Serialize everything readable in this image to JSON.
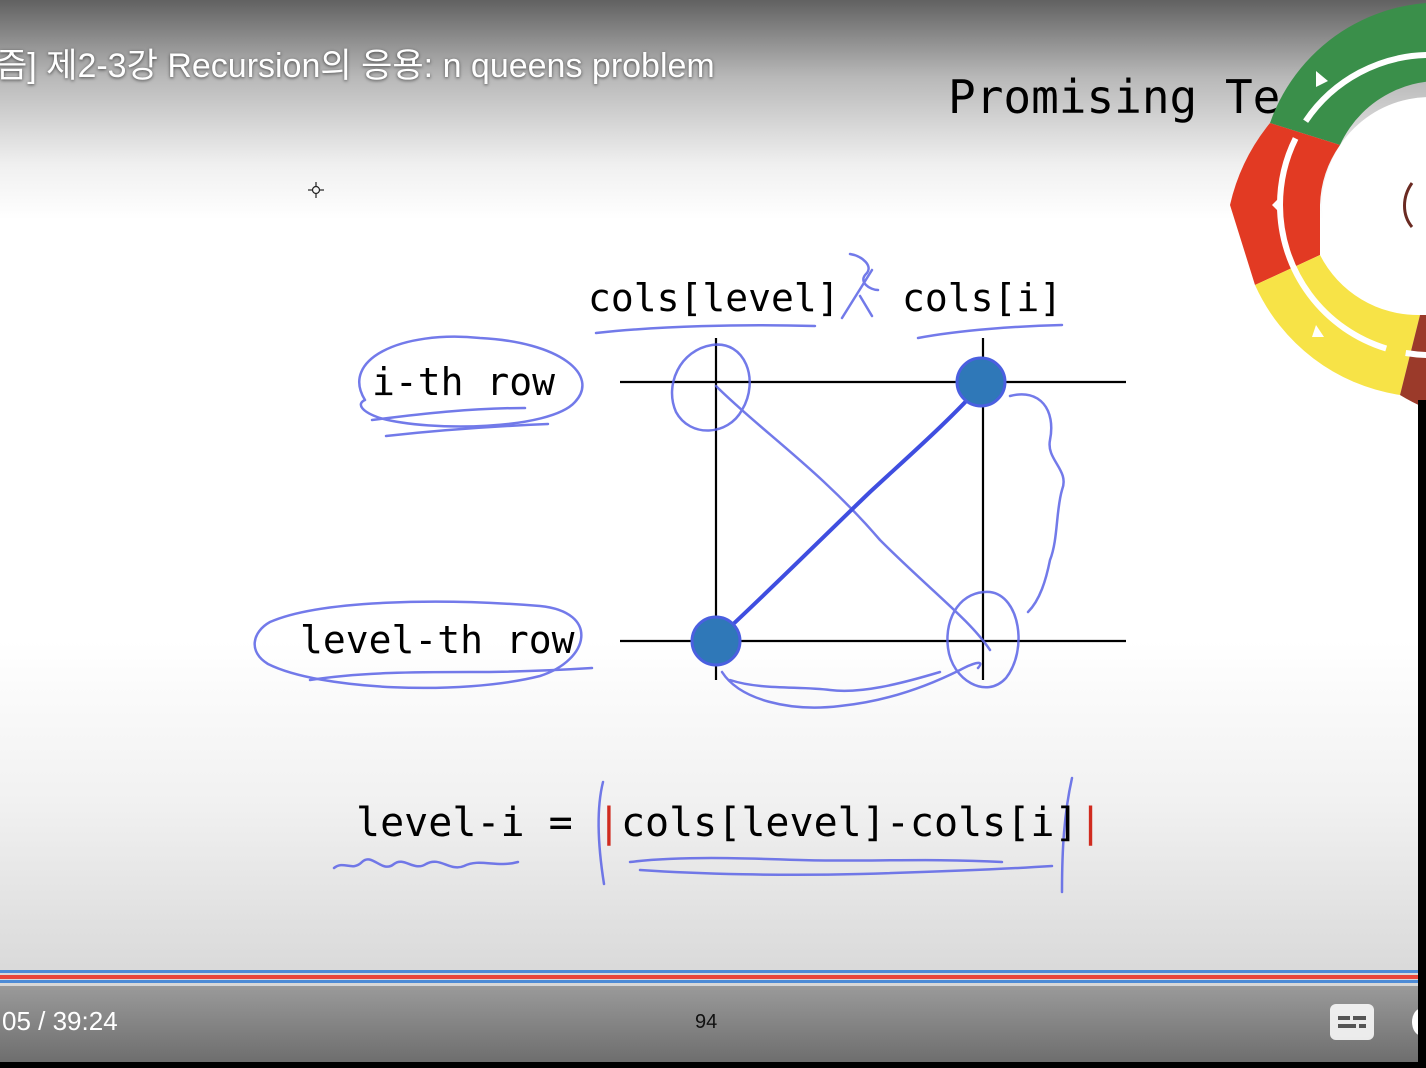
{
  "video": {
    "title": "즘] 제2-3강 Recursion의 응용: n queens problem"
  },
  "slide": {
    "title": "Promising Te",
    "labels": {
      "cols_level": "cols[level]",
      "cols_i": "cols[i]",
      "ith_row": "i-th row",
      "levelth_row": "level-th row"
    },
    "formula": {
      "left": "level-i =",
      "bar_open": "|",
      "body": "cols[level]-cols[i]",
      "bar_close": "|"
    }
  },
  "player": {
    "time_display": "05 / 39:24",
    "page_number": "94",
    "progress_fraction": 1.0
  },
  "colors": {
    "ink_blue": "#5a63e6",
    "queen_fill": "#2f78b8",
    "progress_red": "#e8463a",
    "progress_blue": "#4d8bd6",
    "wheel_green": "#3a8f4a",
    "wheel_red": "#e23a23",
    "wheel_yellow": "#f7e347",
    "wheel_blue": "#1f3fc8",
    "wheel_brown": "#9b3a2a"
  },
  "icons": {
    "cursor": "crosshair-cursor-icon",
    "captions": "closed-captions-icon",
    "settings": "gear-icon",
    "wheel": "pen-color-wheel"
  }
}
